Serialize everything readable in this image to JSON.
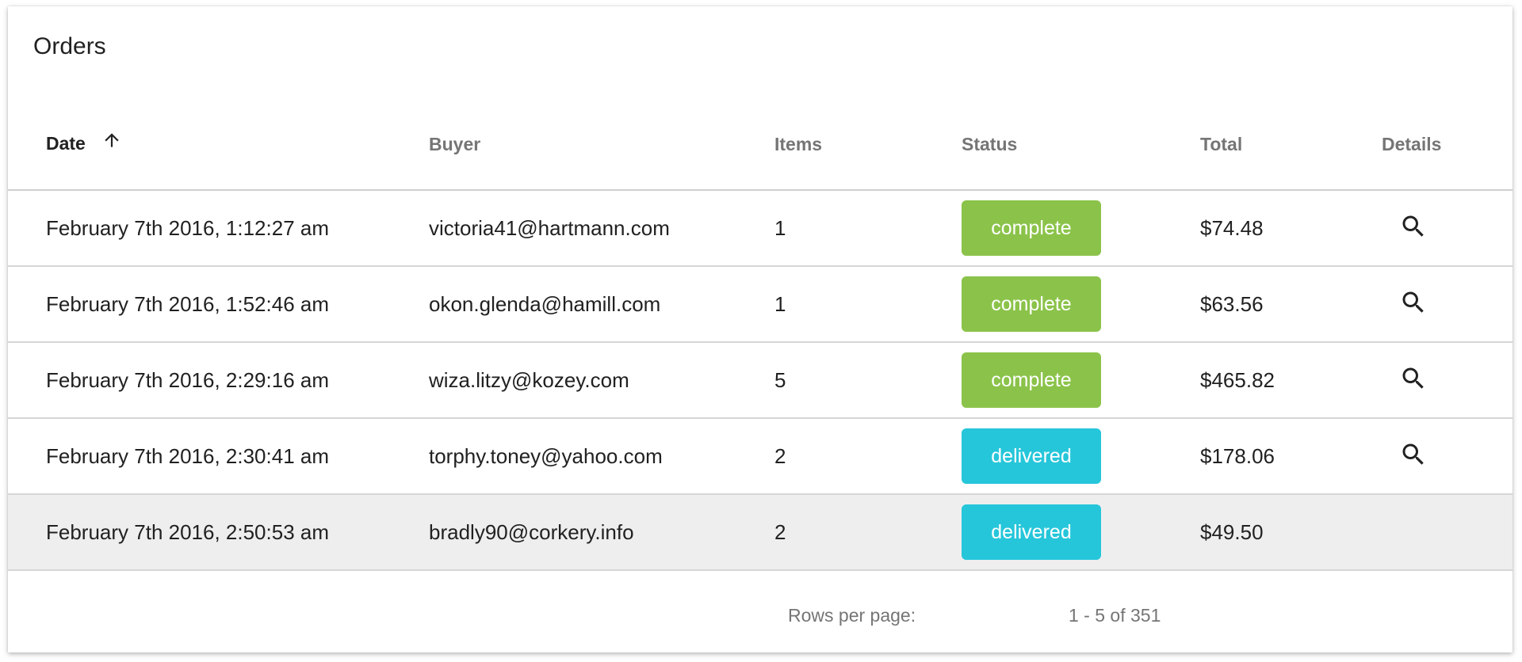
{
  "title": "Orders",
  "columns": {
    "date": "Date",
    "buyer": "Buyer",
    "items": "Items",
    "status": "Status",
    "total": "Total",
    "details": "Details"
  },
  "sort": {
    "column": "date",
    "direction": "ascending",
    "icon": "arrow-up-icon"
  },
  "rows": [
    {
      "date": "February 7th 2016, 1:12:27 am",
      "buyer": "victoria41@hartmann.com",
      "items": "1",
      "status": "complete",
      "total": "$74.48",
      "details_icon": "search-icon"
    },
    {
      "date": "February 7th 2016, 1:52:46 am",
      "buyer": "okon.glenda@hamill.com",
      "items": "1",
      "status": "complete",
      "total": "$63.56",
      "details_icon": "search-icon"
    },
    {
      "date": "February 7th 2016, 2:29:16 am",
      "buyer": "wiza.litzy@kozey.com",
      "items": "5",
      "status": "complete",
      "total": "$465.82",
      "details_icon": "search-icon"
    },
    {
      "date": "February 7th 2016, 2:30:41 am",
      "buyer": "torphy.toney@yahoo.com",
      "items": "2",
      "status": "delivered",
      "total": "$178.06",
      "details_icon": "search-icon"
    },
    {
      "date": "February 7th 2016, 2:50:53 am",
      "buyer": "bradly90@corkery.info",
      "items": "2",
      "status": "delivered",
      "total": "$49.50",
      "details_icon": ""
    }
  ],
  "pagination": {
    "rows_per_page_label": "Rows per page:",
    "range": "1 - 5 of 351"
  },
  "colors": {
    "complete": "#8bc34a",
    "delivered": "#26c6da",
    "hover_row": "#eeeeee"
  }
}
